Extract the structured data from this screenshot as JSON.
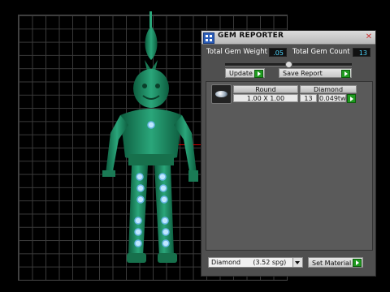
{
  "panel": {
    "title": "GEM REPORTER",
    "total_weight_label": "Total Gem Weight",
    "total_weight_value": ".05",
    "total_count_label": "Total Gem Count",
    "total_count_value": "13",
    "update_label": "Update",
    "save_report_label": "Save Report",
    "table": {
      "headers": [
        "Round",
        "Diamond"
      ],
      "row": {
        "size": "1.00 X 1.00",
        "count": "13",
        "weight": "0.049tw"
      }
    },
    "material_select": "Diamond      (3.52 spg)",
    "set_material_label": "Set Material"
  },
  "colors": {
    "figure": "#1f8f63",
    "gem_highlight": "#bfe8ff",
    "accent_green": "#1f9a1f"
  },
  "icons": {
    "title": "gem-reporter-icon",
    "close": "close-icon",
    "play": "play-arrow-icon",
    "gem": "round-gem-icon",
    "dropdown": "chevron-down-icon"
  }
}
